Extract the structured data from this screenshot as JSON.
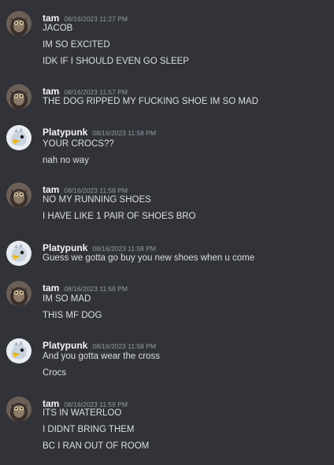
{
  "messages": [
    {
      "author": "tam",
      "avatar_icon": "owl-avatar-icon",
      "timestamp": "08/16/2023 11:27 PM",
      "lines": [
        "JACOB",
        "IM SO EXCITED",
        "IDK IF I SHOULD EVEN GO SLEEP"
      ]
    },
    {
      "author": "tam",
      "avatar_icon": "owl-avatar-icon",
      "timestamp": "08/16/2023 11:57 PM",
      "lines": [
        "THE DOG RIPPED MY FUCKING SHOE IM SO MAD"
      ]
    },
    {
      "author": "Platypunk",
      "avatar_icon": "bird-avatar-icon",
      "timestamp": "08/16/2023 11:58 PM",
      "lines": [
        "YOUR CROCS??",
        "nah no way"
      ]
    },
    {
      "author": "tam",
      "avatar_icon": "owl-avatar-icon",
      "timestamp": "08/16/2023 11:58 PM",
      "lines": [
        "NO MY RUNNING SHOES",
        "I HAVE LIKE 1 PAIR OF SHOES BRO"
      ]
    },
    {
      "author": "Platypunk",
      "avatar_icon": "bird-avatar-icon",
      "timestamp": "08/16/2023 11:58 PM",
      "lines": [
        "Guess we gotta go buy you new shoes when u come"
      ]
    },
    {
      "author": "tam",
      "avatar_icon": "owl-avatar-icon",
      "timestamp": "08/16/2023 11:58 PM",
      "lines": [
        "IM SO MAD",
        "THIS MF DOG"
      ]
    },
    {
      "author": "Platypunk",
      "avatar_icon": "bird-avatar-icon",
      "timestamp": "08/16/2023 11:58 PM",
      "lines": [
        "And you gotta wear the cross",
        "Crocs"
      ]
    },
    {
      "author": "tam",
      "avatar_icon": "owl-avatar-icon",
      "timestamp": "08/16/2023 11:59 PM",
      "lines": [
        "ITS IN WATERLOO",
        "I DIDNT BRING THEM",
        "BC I RAN OUT OF ROOM"
      ]
    }
  ],
  "colors": {
    "background": "#313338",
    "username": "#f2f3f5",
    "timestamp": "#949ba4",
    "text": "#dbdee1"
  }
}
